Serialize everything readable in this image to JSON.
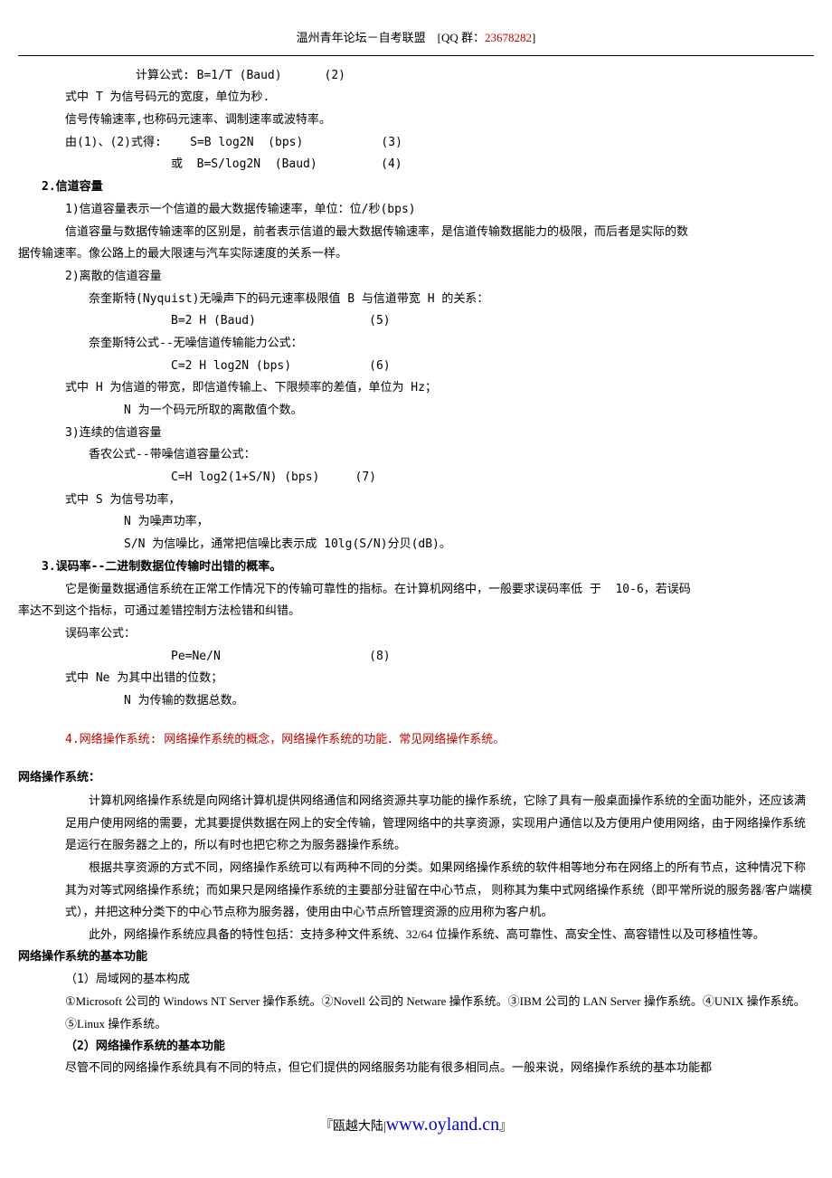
{
  "header": {
    "site": "温州青年论坛－自考联盟",
    "qq_label": "[QQ 群：",
    "qq_number": "23678282",
    "qq_close": "]"
  },
  "lines": {
    "l01": "计算公式: B=1/T (Baud)      (2)",
    "l02": "式中 T 为信号码元的宽度，单位为秒.",
    "l03": "信号传输速率,也称码元速率、调制速率或波特率。",
    "l04": "由(1)、(2)式得:    S=B log2N  (bps)           (3)",
    "l05": "或  B=S/log2N  (Baud)         (4)",
    "h2": "2.信道容量",
    "l06": "1)信道容量表示一个信道的最大数据传输速率，单位：位/秒(bps)",
    "l07a": "信道容量与数据传输速率的区别是，前者表示信道的最大数据传输速率，是信道传输数据能力的极限，而后者是实际的数",
    "l07b": "据传输速率。像公路上的最大限速与汽车实际速度的关系一样。",
    "l08": "2)离散的信道容量",
    "l09": "奈奎斯特(Nyquist)无噪声下的码元速率极限值 B 与信道带宽 H 的关系：",
    "l10": "B=2 H (Baud)                (5)",
    "l11": "奈奎斯特公式--无噪信道传输能力公式：",
    "l12": "C=2 H log2N (bps)           (6)",
    "l13": "式中 H 为信道的带宽，即信道传输上、下限频率的差值，单位为 Hz；",
    "l14": "N 为一个码元所取的离散值个数。",
    "l15": "3)连续的信道容量",
    "l16": "香农公式--带噪信道容量公式：",
    "l17": "C=H log2(1+S/N) (bps)     (7)",
    "l18": "式中 S 为信号功率，",
    "l19": "N 为噪声功率，",
    "l20": "S/N 为信噪比，通常把信噪比表示成 10lg(S/N)分贝(dB)。",
    "h3": "3.误码率--二进制数据位传输时出错的概率。",
    "l21a": "它是衡量数据通信系统在正常工作情况下的传输可靠性的指标。在计算机网络中，一般要求误码率低 于  10-6，若误码",
    "l21b": "率达不到这个指标，可通过差错控制方法检错和纠错。",
    "l22": "误码率公式：",
    "l23": "Pe=Ne/N                     (8)",
    "l24": "式中 Ne 为其中出错的位数；",
    "l25": "N 为传输的数据总数。",
    "h4": "4.网络操作系统: 网络操作系统的概念，网络操作系统的功能．常见网络操作系统。",
    "h_os": "网络操作系统：",
    "p1": "计算机网络操作系统是向网络计算机提供网络通信和网络资源共享功能的操作系统，它除了具有一般桌面操作系统的全面功能外，还应该满足用户使用网络的需要，尤其要提供数据在网上的安全传输，管理网络中的共享资源，实现用户通信以及方便用户使用网络，由于网络操作系统是运行在服务器之上的，所以有时也把它称之为服务器操作系统。",
    "p2": "根据共享资源的方式不同，网络操作系统可以有两种不同的分类。如果网络操作系统的软件相等地分布在网络上的所有节点，这种情况下称其为对等式网络操作系统；而如果只是网络操作系统的主要部分驻留在中心节点， 则称其为集中式网络操作系统（即平常所说的服务器/客户端模式），并把这种分类下的中心节点称为服务器，使用由中心节点所管理资源的应用称为客户机。",
    "p3": "此外，网络操作系统应具备的特性包括：支持多种文件系统、32/64 位操作系统、高可靠性、高安全性、高容错性以及可移植性等。",
    "h_fn": "网络操作系统的基本功能",
    "f1": "（1）局域网的基本构成",
    "f2": "①Microsoft 公司的 Windows NT Server 操作系统。②Novell 公司的 Netware 操作系统。③IBM 公司的 LAN Server 操作系统。④UNIX 操作系统。⑤Linux 操作系统。",
    "f3": "（2）网络操作系统的基本功能",
    "f4": "尽管不同的网络操作系统具有不同的特点，但它们提供的网络服务功能有很多相同点。一般来说，网络操作系统的基本功能都"
  },
  "footer": {
    "prefix": "『瓯越大陆|",
    "url": "www.oyland.cn",
    "suffix": "』"
  }
}
